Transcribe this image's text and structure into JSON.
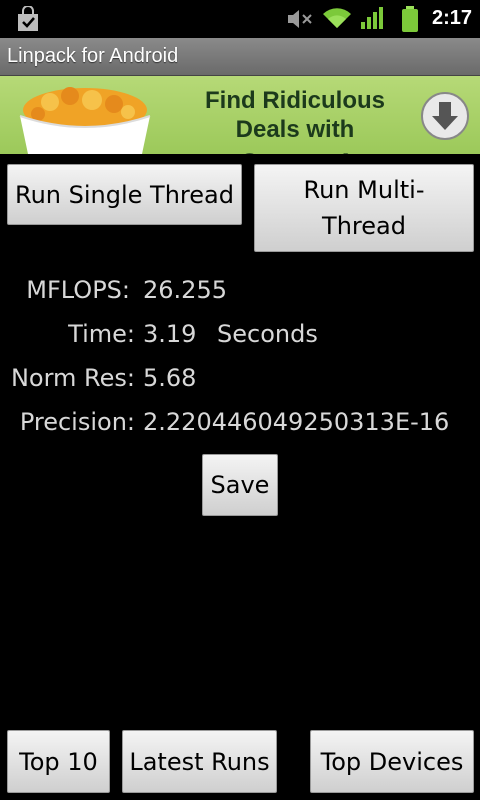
{
  "status_bar": {
    "time": "2:17",
    "icons": [
      "shopping-bag-icon",
      "volume-muted-icon",
      "wifi-icon",
      "signal-icon",
      "battery-icon"
    ]
  },
  "app_title": "Linpack for Android",
  "ad": {
    "line1": "Find Ridiculous",
    "line2": "Deals with Groupon",
    "trademark": "®",
    "icon": "download-arrow-icon"
  },
  "buttons": {
    "run_single": "Run Single Thread",
    "run_multi_line1": "Run Multi-",
    "run_multi_line2": "Thread",
    "save": "Save",
    "top10": "Top 10",
    "latest_runs": "Latest Runs",
    "top_devices": "Top Devices"
  },
  "results": {
    "mflops_label": "MFLOPS:",
    "mflops_value": "26.255",
    "time_label": "Time:",
    "time_value": "3.19",
    "time_unit": "Seconds",
    "normres_label": "Norm Res:",
    "normres_value": "5.68",
    "precision_label": "Precision:",
    "precision_value": "2.220446049250313E-16"
  },
  "colors": {
    "ad_green": "#a8d26a",
    "titlebar_gray": "#7a7a7a",
    "wifi_green": "#7cc93a"
  }
}
